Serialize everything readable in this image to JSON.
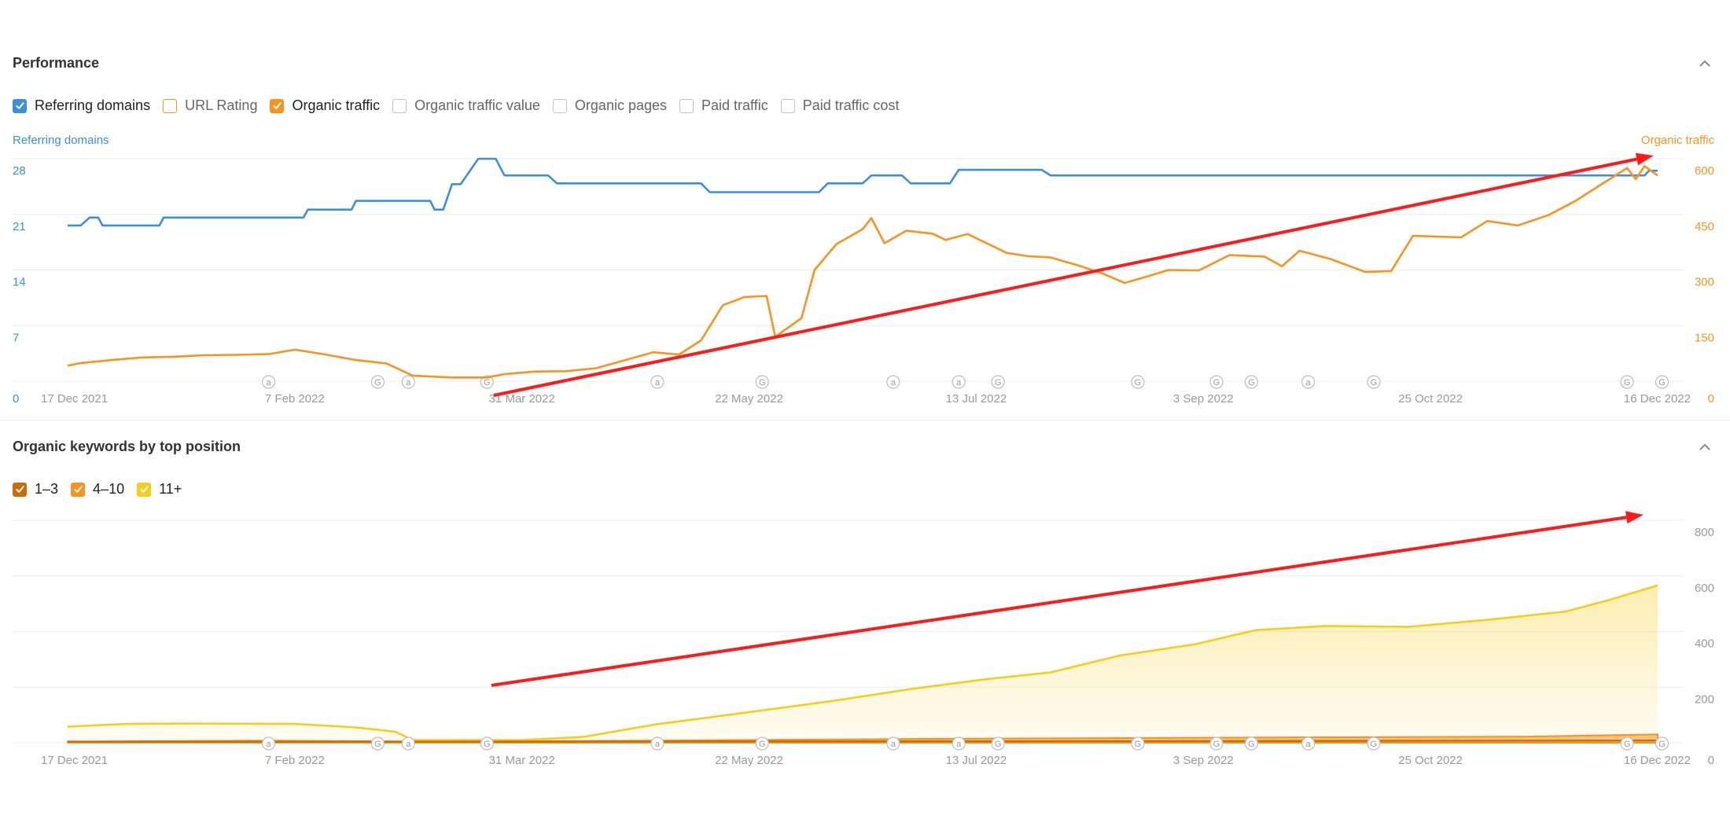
{
  "performance": {
    "title": "Performance",
    "legend": [
      {
        "label": "Referring domains",
        "checked": true,
        "color": "#3c8fde",
        "bold": true
      },
      {
        "label": "URL Rating",
        "checked": false,
        "color": "#f7931e",
        "bold": false,
        "colored_box": true
      },
      {
        "label": "Organic traffic",
        "checked": true,
        "color": "#f7931e",
        "bold": true
      },
      {
        "label": "Organic traffic value",
        "checked": false,
        "color": "#c2c2c2",
        "bold": false
      },
      {
        "label": "Organic pages",
        "checked": false,
        "color": "#c2c2c2",
        "bold": false
      },
      {
        "label": "Paid traffic",
        "checked": false,
        "color": "#c2c2c2",
        "bold": false
      },
      {
        "label": "Paid traffic cost",
        "checked": false,
        "color": "#c2c2c2",
        "bold": false
      }
    ],
    "left_axis_title": "Referring domains",
    "right_axis_title": "Organic traffic"
  },
  "keywords": {
    "title": "Organic keywords by top position",
    "legend": [
      {
        "label": "1–3",
        "checked": true,
        "color": "#c96d0b"
      },
      {
        "label": "4–10",
        "checked": true,
        "color": "#f7931e"
      },
      {
        "label": "11+",
        "checked": true,
        "color": "#f7cc1d"
      }
    ]
  },
  "colors": {
    "referring_domains": "#3c8fde",
    "organic_traffic": "#f7931e",
    "kw_11plus": "#f7cc1d",
    "kw_4_10": "#f7931e",
    "kw_1_3": "#c96d0b",
    "annotation_arrow": "#ff1a1a",
    "grid": "#ececec",
    "axis_text": "#999999"
  },
  "chart_data": [
    {
      "type": "line",
      "title": "Performance",
      "x_type": "date",
      "xlim": [
        "2021-12-17",
        "2022-12-16"
      ],
      "x_ticks": [
        "17 Dec 2021",
        "7 Feb 2022",
        "31 Mar 2022",
        "22 May 2022",
        "13 Jul 2022",
        "3 Sep 2022",
        "25 Oct 2022",
        "16 Dec 2022"
      ],
      "y_left": {
        "label": "Referring domains",
        "ticks": [
          "0",
          "7",
          "14",
          "21",
          "28"
        ],
        "ylim": [
          0,
          28
        ]
      },
      "y_right": {
        "label": "Organic traffic",
        "ticks": [
          "0",
          "150",
          "300",
          "450",
          "600"
        ],
        "ylim": [
          0,
          600
        ]
      },
      "grid": true,
      "event_markers": [
        {
          "date": "2022-02-01",
          "label": "a"
        },
        {
          "date": "2022-02-26",
          "label": "G"
        },
        {
          "date": "2022-03-05",
          "label": "a"
        },
        {
          "date": "2022-03-23",
          "label": "G"
        },
        {
          "date": "2022-05-01",
          "label": "a"
        },
        {
          "date": "2022-05-25",
          "label": "G"
        },
        {
          "date": "2022-06-24",
          "label": "a"
        },
        {
          "date": "2022-07-09",
          "label": "a"
        },
        {
          "date": "2022-07-18",
          "label": "G"
        },
        {
          "date": "2022-08-19",
          "label": "G"
        },
        {
          "date": "2022-09-06",
          "label": "G"
        },
        {
          "date": "2022-09-14",
          "label": "G"
        },
        {
          "date": "2022-09-27",
          "label": "a"
        },
        {
          "date": "2022-10-12",
          "label": "G"
        },
        {
          "date": "2022-12-09",
          "label": "G"
        },
        {
          "date": "2022-12-17",
          "label": "G"
        }
      ],
      "series": [
        {
          "name": "Referring domains",
          "axis": "left",
          "points": [
            [
              "2021-12-17",
              19.6
            ],
            [
              "2021-12-20",
              19.6
            ],
            [
              "2021-12-22",
              20.6
            ],
            [
              "2021-12-24",
              20.6
            ],
            [
              "2021-12-25",
              19.6
            ],
            [
              "2022-01-07",
              19.6
            ],
            [
              "2022-01-08",
              20.6
            ],
            [
              "2022-01-26",
              20.6
            ],
            [
              "2022-02-09",
              20.6
            ],
            [
              "2022-02-10",
              21.6
            ],
            [
              "2022-02-20",
              21.6
            ],
            [
              "2022-02-21",
              22.7
            ],
            [
              "2022-03-10",
              22.7
            ],
            [
              "2022-03-11",
              21.6
            ],
            [
              "2022-03-13",
              21.6
            ],
            [
              "2022-03-15",
              24.8
            ],
            [
              "2022-03-17",
              24.8
            ],
            [
              "2022-03-21",
              28.0
            ],
            [
              "2022-03-25",
              28.0
            ],
            [
              "2022-03-27",
              25.9
            ],
            [
              "2022-04-06",
              25.9
            ],
            [
              "2022-04-08",
              24.9
            ],
            [
              "2022-05-11",
              24.9
            ],
            [
              "2022-05-13",
              23.8
            ],
            [
              "2022-06-07",
              23.8
            ],
            [
              "2022-06-09",
              24.9
            ],
            [
              "2022-06-17",
              24.9
            ],
            [
              "2022-06-19",
              25.9
            ],
            [
              "2022-06-26",
              25.9
            ],
            [
              "2022-06-28",
              24.9
            ],
            [
              "2022-07-07",
              24.9
            ],
            [
              "2022-07-09",
              26.6
            ],
            [
              "2022-07-28",
              26.6
            ],
            [
              "2022-07-30",
              25.9
            ],
            [
              "2022-12-13",
              25.9
            ],
            [
              "2022-12-14",
              26.5
            ],
            [
              "2022-12-16",
              26.5
            ]
          ]
        },
        {
          "name": "Organic traffic",
          "axis": "right",
          "points": [
            [
              "2021-12-17",
              42
            ],
            [
              "2021-12-20",
              49
            ],
            [
              "2021-12-27",
              57
            ],
            [
              "2022-01-03",
              64
            ],
            [
              "2022-01-10",
              66
            ],
            [
              "2022-01-17",
              70
            ],
            [
              "2022-01-24",
              71
            ],
            [
              "2022-02-01",
              73
            ],
            [
              "2022-02-07",
              85
            ],
            [
              "2022-02-14",
              72
            ],
            [
              "2022-02-21",
              57
            ],
            [
              "2022-02-28",
              48
            ],
            [
              "2022-03-06",
              15
            ],
            [
              "2022-03-15",
              10
            ],
            [
              "2022-03-23",
              10
            ],
            [
              "2022-03-27",
              19
            ],
            [
              "2022-04-03",
              26
            ],
            [
              "2022-04-10",
              27
            ],
            [
              "2022-04-17",
              35
            ],
            [
              "2022-04-24",
              58
            ],
            [
              "2022-04-30",
              78
            ],
            [
              "2022-05-06",
              72
            ],
            [
              "2022-05-11",
              110
            ],
            [
              "2022-05-16",
              205
            ],
            [
              "2022-05-21",
              227
            ],
            [
              "2022-05-26",
              230
            ],
            [
              "2022-05-28",
              120
            ],
            [
              "2022-06-03",
              170
            ],
            [
              "2022-06-06",
              300
            ],
            [
              "2022-06-11",
              370
            ],
            [
              "2022-06-17",
              410
            ],
            [
              "2022-06-19",
              440
            ],
            [
              "2022-06-22",
              372
            ],
            [
              "2022-06-27",
              406
            ],
            [
              "2022-07-03",
              398
            ],
            [
              "2022-07-06",
              381
            ],
            [
              "2022-07-11",
              397
            ],
            [
              "2022-07-20",
              346
            ],
            [
              "2022-07-25",
              337
            ],
            [
              "2022-07-30",
              334
            ],
            [
              "2022-08-06",
              310
            ],
            [
              "2022-08-11",
              290
            ],
            [
              "2022-08-16",
              265
            ],
            [
              "2022-08-21",
              282
            ],
            [
              "2022-08-26",
              300
            ],
            [
              "2022-09-02",
              299
            ],
            [
              "2022-09-09",
              340
            ],
            [
              "2022-09-17",
              336
            ],
            [
              "2022-09-21",
              310
            ],
            [
              "2022-09-25",
              352
            ],
            [
              "2022-10-02",
              330
            ],
            [
              "2022-10-10",
              295
            ],
            [
              "2022-10-16",
              297
            ],
            [
              "2022-10-21",
              392
            ],
            [
              "2022-11-01",
              388
            ],
            [
              "2022-11-07",
              432
            ],
            [
              "2022-11-14",
              420
            ],
            [
              "2022-11-21",
              448
            ],
            [
              "2022-11-27",
              485
            ],
            [
              "2022-12-03",
              530
            ],
            [
              "2022-12-07",
              560
            ],
            [
              "2022-12-09",
              575
            ],
            [
              "2022-12-11",
              545
            ],
            [
              "2022-12-13",
              580
            ],
            [
              "2022-12-16",
              555
            ]
          ]
        }
      ]
    },
    {
      "type": "area",
      "title": "Organic keywords by top position",
      "stacked": true,
      "x_type": "date",
      "xlim": [
        "2021-12-17",
        "2022-12-16"
      ],
      "x_ticks": [
        "17 Dec 2021",
        "7 Feb 2022",
        "31 Mar 2022",
        "22 May 2022",
        "13 Jul 2022",
        "3 Sep 2022",
        "25 Oct 2022",
        "16 Dec 2022"
      ],
      "y_right": {
        "ticks": [
          "0",
          "200",
          "400",
          "600",
          "800"
        ],
        "ylim": [
          0,
          800
        ]
      },
      "grid": true,
      "series": [
        {
          "name": "1–3",
          "points": [
            [
              "2021-12-17",
              4
            ],
            [
              "2022-03-10",
              4
            ],
            [
              "2022-06-01",
              5
            ],
            [
              "2022-09-01",
              6
            ],
            [
              "2022-12-16",
              8
            ]
          ]
        },
        {
          "name": "4–10",
          "points": [
            [
              "2021-12-17",
              4
            ],
            [
              "2022-02-01",
              8
            ],
            [
              "2022-03-10",
              4
            ],
            [
              "2022-05-01",
              8
            ],
            [
              "2022-07-01",
              14
            ],
            [
              "2022-09-01",
              18
            ],
            [
              "2022-11-15",
              22
            ],
            [
              "2022-12-16",
              30
            ]
          ]
        },
        {
          "name": "11+",
          "points": [
            [
              "2021-12-17",
              58
            ],
            [
              "2021-12-31",
              68
            ],
            [
              "2022-01-14",
              69
            ],
            [
              "2022-02-07",
              68
            ],
            [
              "2022-02-21",
              55
            ],
            [
              "2022-03-02",
              40
            ],
            [
              "2022-03-06",
              10
            ],
            [
              "2022-03-31",
              10
            ],
            [
              "2022-04-14",
              21
            ],
            [
              "2022-05-01",
              67
            ],
            [
              "2022-05-22",
              110
            ],
            [
              "2022-06-10",
              150
            ],
            [
              "2022-06-28",
              193
            ],
            [
              "2022-07-15",
              228
            ],
            [
              "2022-07-30",
              253
            ],
            [
              "2022-08-15",
              314
            ],
            [
              "2022-09-01",
              354
            ],
            [
              "2022-09-15",
              405
            ],
            [
              "2022-10-01",
              420
            ],
            [
              "2022-10-20",
              417
            ],
            [
              "2022-11-07",
              442
            ],
            [
              "2022-11-25",
              472
            ],
            [
              "2022-12-05",
              514
            ],
            [
              "2022-12-16",
              566
            ]
          ]
        }
      ]
    }
  ]
}
